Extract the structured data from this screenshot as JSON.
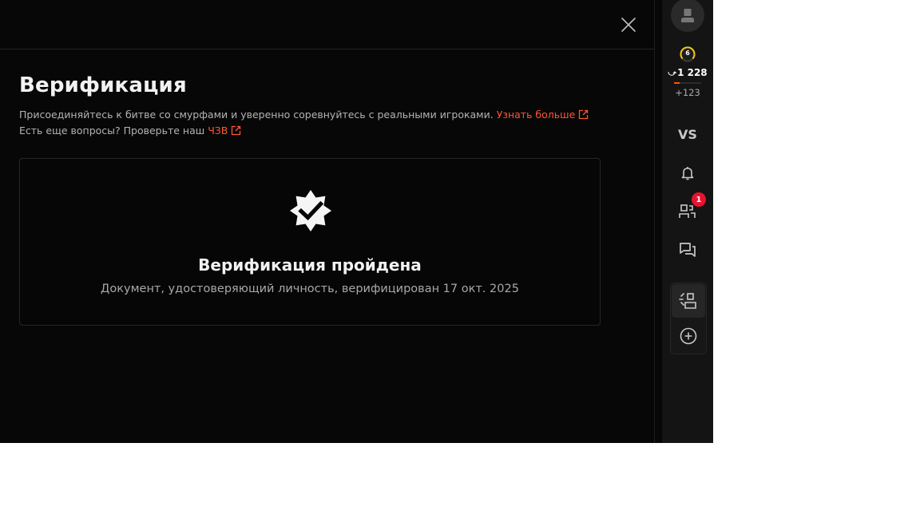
{
  "modal": {
    "title": "Верификация",
    "description_line1": "Присоединяйтесь к битве со смурфами и уверенно соревнуйтесь с реальными игроками.",
    "learn_more_link": "Узнать больше",
    "description_line2": "Есть еще вопросы? Проверьте наш",
    "faq_link": "ЧЗВ",
    "status_card": {
      "title": "Верификация пройдена",
      "subtitle": "Документ, удостоверяющий личность, верифицирован 17 окт. 2025"
    },
    "icons": {
      "close": "close-icon",
      "external_link": "external-link-icon",
      "verified_badge": "verified-badge-icon"
    }
  },
  "sidebar": {
    "level": "6",
    "elo": "1 228",
    "elo_delta": "+123",
    "vs_label": "VS",
    "friends_notification_count": "1",
    "icons": [
      "user-avatar-icon",
      "level-badge-icon",
      "bell-icon",
      "friends-icon",
      "chat-icon",
      "party-icon",
      "add-circle-icon"
    ]
  },
  "colors": {
    "background": "#070707",
    "accent_link": "#ff5533",
    "level_gold": "#f5c518",
    "notification_red": "#e8132e",
    "text_primary": "#f2f2f2",
    "text_secondary": "#b3b3b3"
  }
}
